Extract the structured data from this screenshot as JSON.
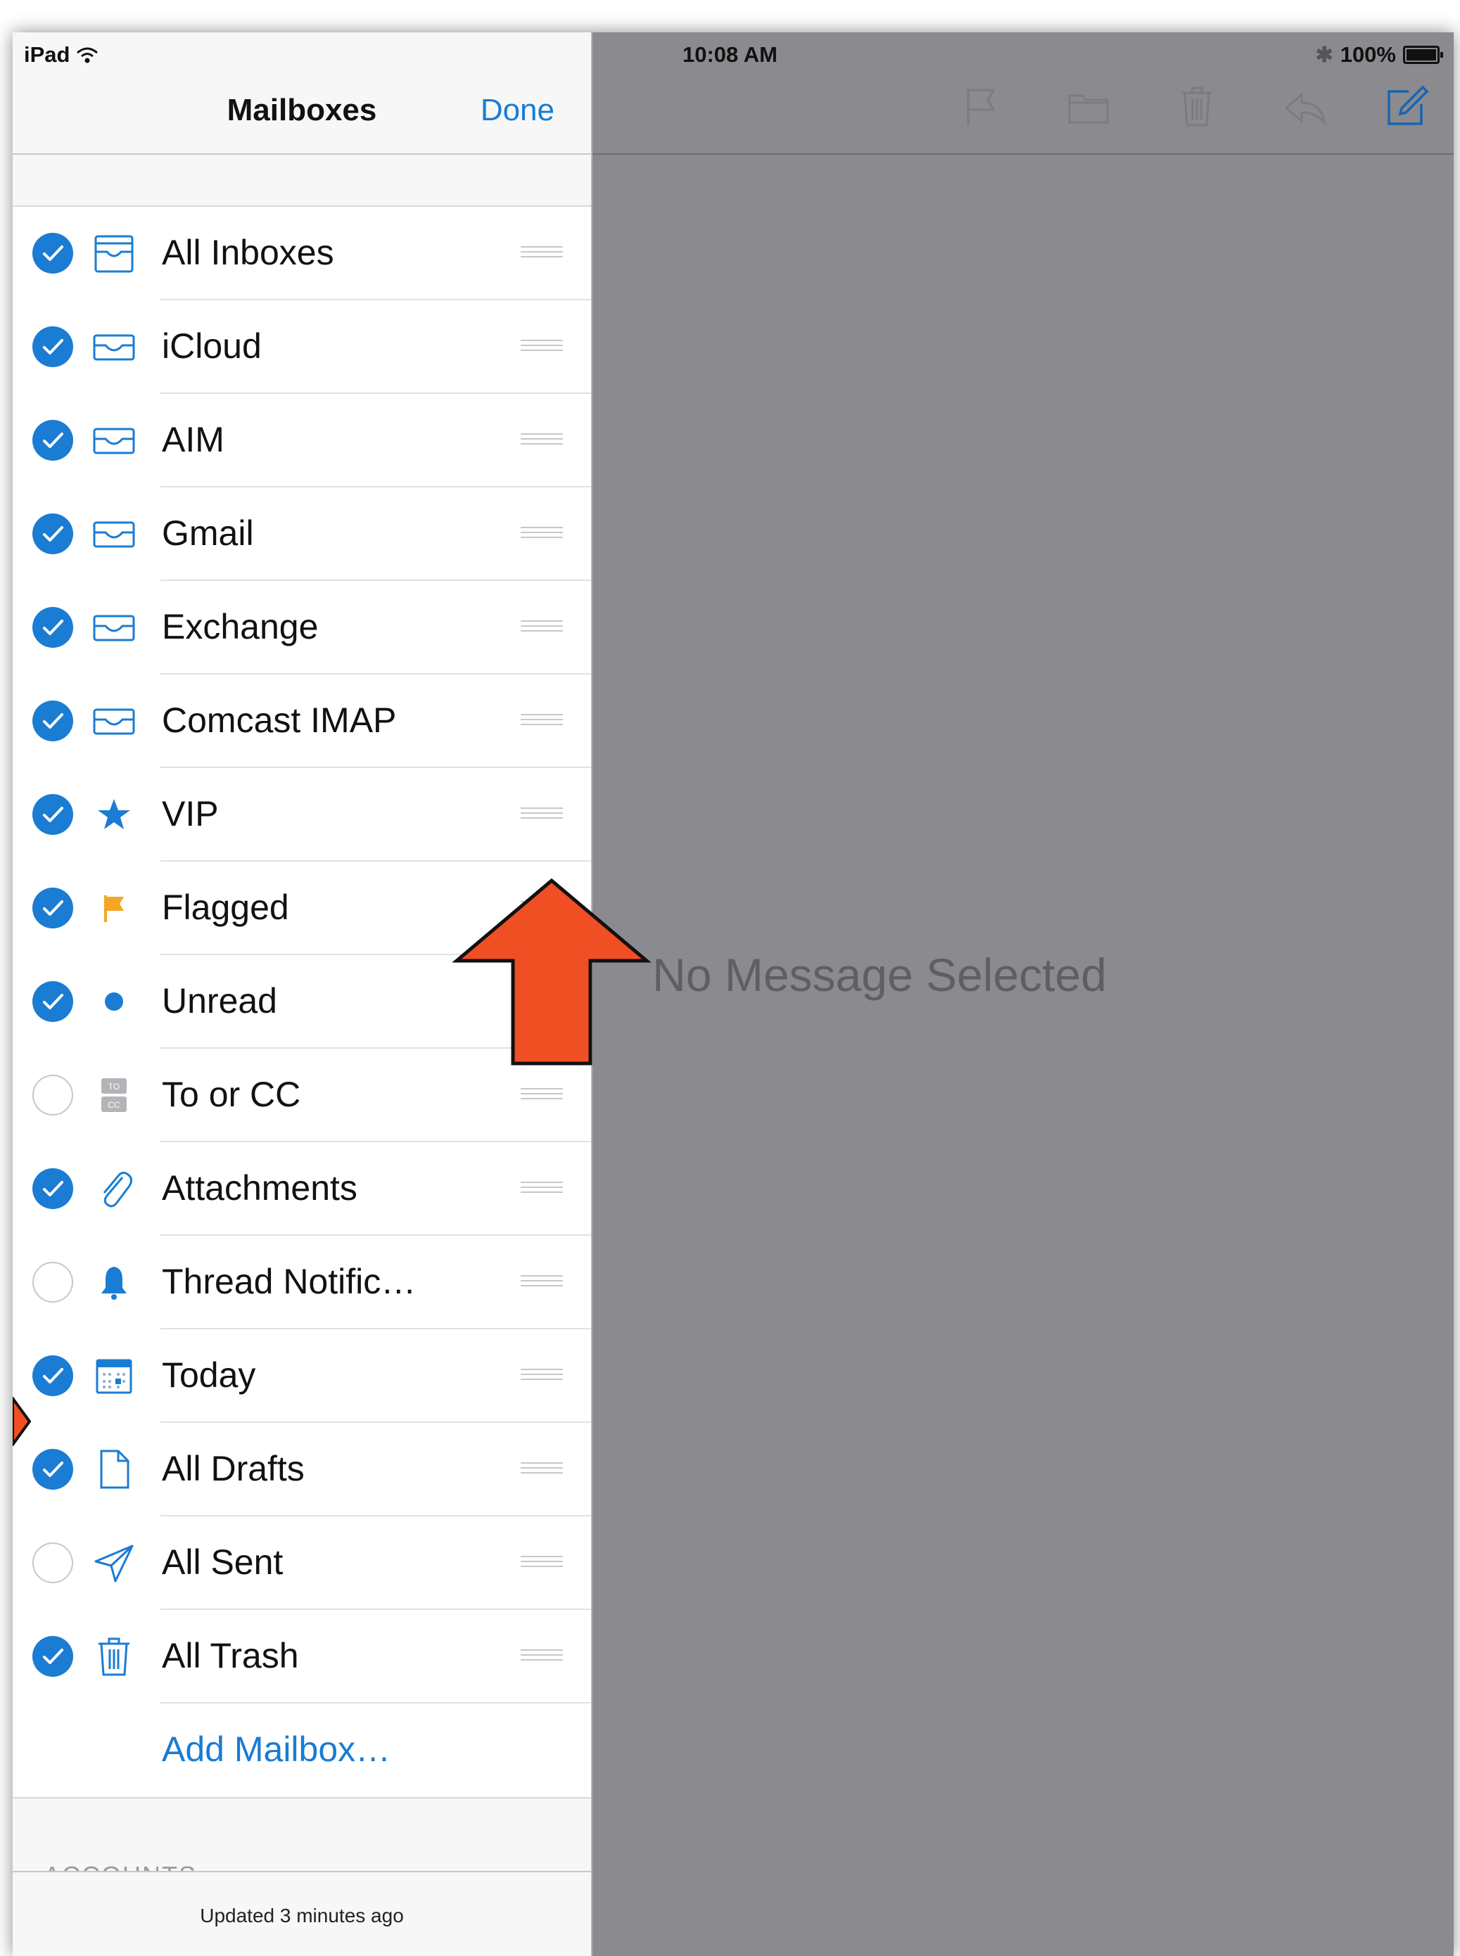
{
  "status_bar": {
    "carrier": "iPad",
    "time": "10:08 AM",
    "battery": "100%"
  },
  "nav": {
    "title": "Mailboxes",
    "done_label": "Done"
  },
  "mailboxes": [
    {
      "label": "All Inboxes",
      "checked": true,
      "icon": "all-inboxes-icon"
    },
    {
      "label": "iCloud",
      "checked": true,
      "icon": "inbox-icon"
    },
    {
      "label": "AIM",
      "checked": true,
      "icon": "inbox-icon"
    },
    {
      "label": "Gmail",
      "checked": true,
      "icon": "inbox-icon"
    },
    {
      "label": "Exchange",
      "checked": true,
      "icon": "inbox-icon"
    },
    {
      "label": "Comcast IMAP",
      "checked": true,
      "icon": "inbox-icon"
    },
    {
      "label": "VIP",
      "checked": true,
      "icon": "star-icon"
    },
    {
      "label": "Flagged",
      "checked": true,
      "icon": "flag-icon"
    },
    {
      "label": "Unread",
      "checked": true,
      "icon": "unread-dot-icon"
    },
    {
      "label": "To or CC",
      "checked": false,
      "icon": "to-cc-icon"
    },
    {
      "label": "Attachments",
      "checked": true,
      "icon": "paperclip-icon"
    },
    {
      "label": "Thread Notific…",
      "checked": false,
      "icon": "bell-icon"
    },
    {
      "label": "Today",
      "checked": true,
      "icon": "calendar-icon"
    },
    {
      "label": "All Drafts",
      "checked": true,
      "icon": "document-icon"
    },
    {
      "label": "All Sent",
      "checked": false,
      "icon": "sent-icon"
    },
    {
      "label": "All Trash",
      "checked": true,
      "icon": "trash-icon"
    }
  ],
  "add_mailbox_label": "Add Mailbox…",
  "accounts_header": "ACCOUNTS",
  "footer": {
    "updated": "Updated 3 minutes ago"
  },
  "detail": {
    "empty_message": "No Message Selected"
  },
  "colors": {
    "accent": "#1a7cd3",
    "callout_arrow": "#f04e23",
    "flag": "#f5a623"
  }
}
